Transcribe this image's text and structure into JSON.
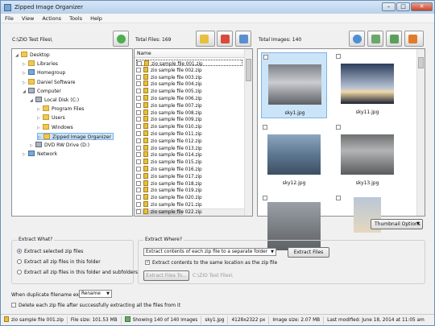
{
  "title": "Zipped Image Organizer",
  "window_controls": {
    "minimize": "–",
    "maximize": "□",
    "close": "✕"
  },
  "menu": [
    "File",
    "View",
    "Actions",
    "Tools",
    "Help"
  ],
  "path": "C:\\ZIO Test Files\\",
  "total_files_label": "Total Files: 169",
  "total_images_label": "Total Images: 140",
  "tree": [
    {
      "label": "Desktop",
      "icon": "folder",
      "depth": 0,
      "arrow": "◢"
    },
    {
      "label": "Libraries",
      "icon": "folder",
      "depth": 1,
      "arrow": "▷"
    },
    {
      "label": "Homegroup",
      "icon": "net",
      "depth": 1,
      "arrow": "▷"
    },
    {
      "label": "Daniel Software",
      "icon": "folder",
      "depth": 1,
      "arrow": "▷"
    },
    {
      "label": "Computer",
      "icon": "drive",
      "depth": 1,
      "arrow": "◢"
    },
    {
      "label": "Local Disk (C:)",
      "icon": "drive",
      "depth": 2,
      "arrow": "◢"
    },
    {
      "label": "Program Files",
      "icon": "folder",
      "depth": 3,
      "arrow": "▷"
    },
    {
      "label": "Users",
      "icon": "folder",
      "depth": 3,
      "arrow": "▷"
    },
    {
      "label": "Windows",
      "icon": "folder",
      "depth": 3,
      "arrow": "▷"
    },
    {
      "label": "Zipped Image Organizer",
      "icon": "folder",
      "depth": 3,
      "arrow": "▷"
    },
    {
      "label": "DVD RW Drive (D:)",
      "icon": "drive",
      "depth": 2,
      "arrow": "▷"
    },
    {
      "label": "Network",
      "icon": "net",
      "depth": 1,
      "arrow": "▷"
    }
  ],
  "file_list": {
    "header": "Name",
    "files": [
      "zio sample file 001.zip",
      "zio sample file 002.zip",
      "zio sample file 003.zip",
      "zio sample file 004.zip",
      "zio sample file 005.zip",
      "zio sample file 006.zip",
      "zio sample file 007.zip",
      "zio sample file 008.zip",
      "zio sample file 009.zip",
      "zio sample file 010.zip",
      "zio sample file 011.zip",
      "zio sample file 012.zip",
      "zio sample file 013.zip",
      "zio sample file 014.zip",
      "zio sample file 015.zip",
      "zio sample file 016.zip",
      "zio sample file 017.zip",
      "zio sample file 018.zip",
      "zio sample file 019.zip",
      "zio sample file 020.zip",
      "zio sample file 021.zip",
      "zio sample file 022.zip"
    ]
  },
  "thumbnails": [
    {
      "name": "sky1.jpg"
    },
    {
      "name": "sky11.jpg"
    },
    {
      "name": "sky12.jpg"
    },
    {
      "name": "sky13.jpg"
    },
    {
      "name": ""
    },
    {
      "name": ""
    }
  ],
  "thumbnail_options": "Thumbnail Options",
  "extract_what": {
    "title": "Extract What?",
    "options": [
      "Extract selected zip files",
      "Extract all zip files in this folder",
      "Extract all zip files in this folder and subfolders"
    ],
    "selected": 0
  },
  "extract_where": {
    "title": "Extract Where?",
    "mode": "Extract contents of each zip file to a separate folder",
    "same_location": "Extract contents to the same location as the zip file",
    "files_to_button": "Extract Files To...",
    "files_to_path": "C:\\ZIO Test Files\\",
    "extract_button": "Extract Files"
  },
  "duplicate": {
    "label": "When duplicate filename exists:",
    "value": "Rename"
  },
  "delete_after": "Delete each zip file after successfully extracting all the files from it",
  "status": {
    "zip": "zio sample file 001.zip",
    "file_size": "File size: 101.53 MB",
    "showing": "Showing 140 of 140 images",
    "image": "sky1.jpg",
    "dims": "4128x2322 px",
    "image_size": "Image size: 2.07 MB",
    "modified": "Last modified: June 18, 2014 at 11:05 am"
  },
  "colors": {
    "accent": "#1c5fae",
    "selection": "#cce4f7"
  }
}
